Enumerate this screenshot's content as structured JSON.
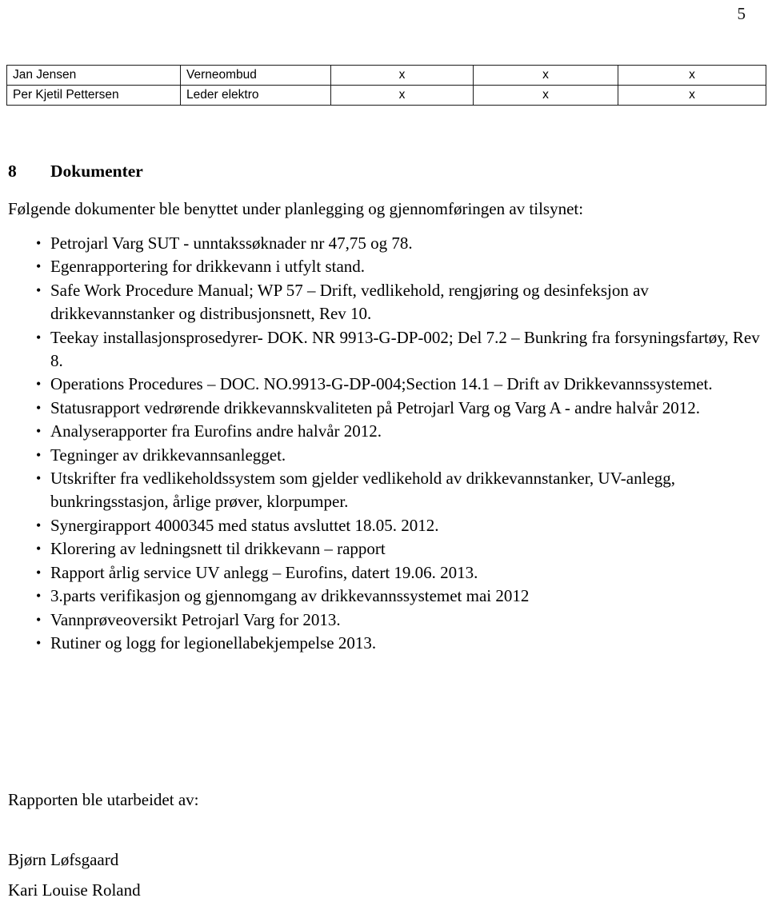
{
  "page": {
    "number": "5"
  },
  "participants_table": {
    "rows": [
      {
        "name": "Jan Jensen",
        "role": "Verneombud",
        "mark1": "x",
        "mark2": "x",
        "mark3": "x"
      },
      {
        "name": "Per Kjetil Pettersen",
        "role": "Leder elektro",
        "mark1": "x",
        "mark2": "x",
        "mark3": "x"
      }
    ]
  },
  "section": {
    "number": "8",
    "title": "Dokumenter",
    "intro": "Følgende dokumenter ble benyttet under planlegging og gjennomføringen av tilsynet:",
    "documents": [
      "Petrojarl Varg SUT - unntakssøknader nr 47,75 og 78.",
      "Egenrapportering for drikkevann i utfylt stand.",
      "Safe Work Procedure Manual; WP 57 – Drift, vedlikehold, rengjøring og desinfeksjon av drikkevannstanker og distribusjonsnett, Rev 10.",
      "Teekay installasjonsprosedyrer- DOK. NR 9913-G-DP-002; Del 7.2 – Bunkring fra forsyningsfartøy, Rev 8.",
      "Operations Procedures – DOC. NO.9913-G-DP-004;Section 14.1 – Drift av Drikkevannssystemet.",
      "Statusrapport vedrørende drikkevannskvaliteten på Petrojarl Varg og Varg A - andre halvår 2012.",
      "Analyserapporter fra Eurofins andre halvår 2012.",
      "Tegninger av drikkevannsanlegget.",
      "Utskrifter fra vedlikeholdssystem som gjelder vedlikehold av drikkevannstanker, UV-anlegg, bunkringsstasjon, årlige prøver, klorpumper.",
      "Synergirapport 4000345 med status avsluttet 18.05. 2012.",
      "Klorering av ledningsnett til drikkevann – rapport",
      "Rapport årlig service UV anlegg – Eurofins, datert 19.06. 2013.",
      "3.parts verifikasjon og gjennomgang av drikkevannssystemet mai 2012",
      "Vannprøveoversikt Petrojarl Varg for 2013.",
      "Rutiner og logg for legionellabekjempelse 2013."
    ]
  },
  "signature": {
    "intro": "Rapporten ble utarbeidet av:",
    "author_1": "Bjørn Løfsgaard",
    "author_2": "Kari Louise Roland"
  }
}
